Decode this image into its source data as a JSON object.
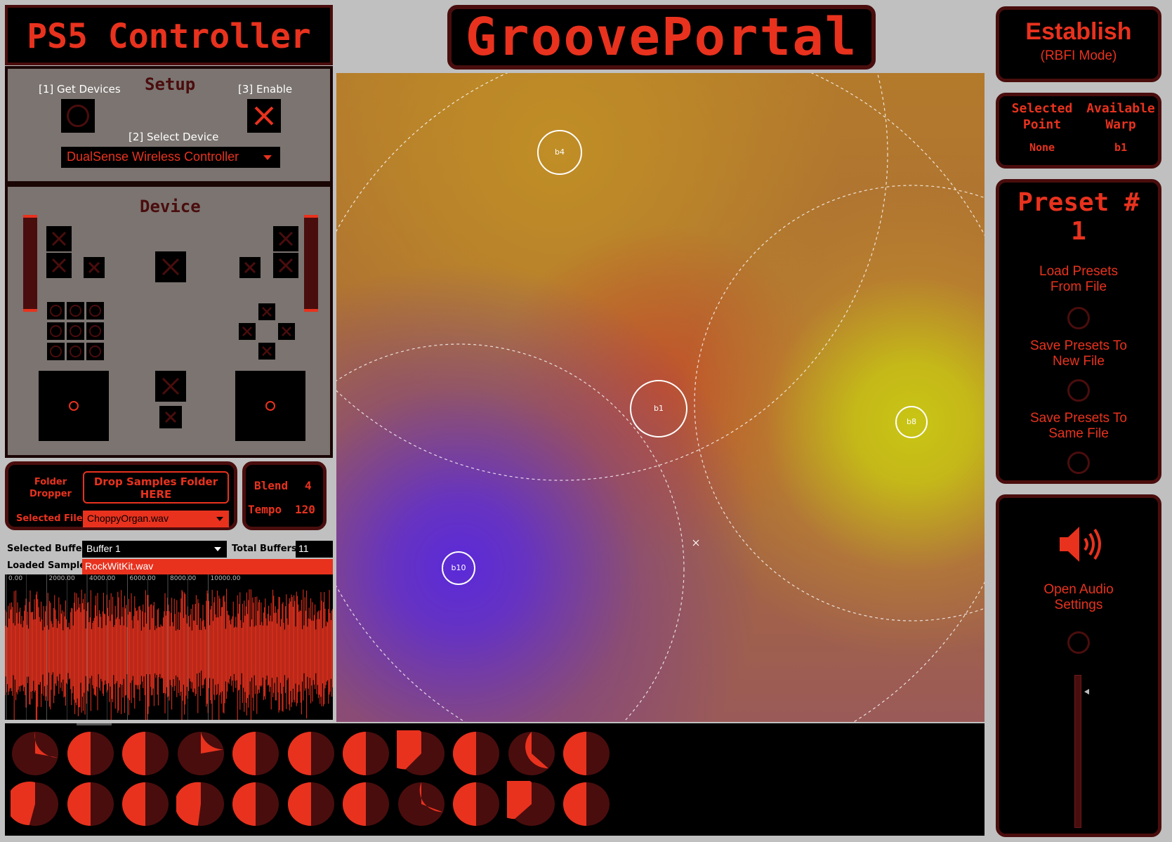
{
  "controller": {
    "title": "PS5 Controller",
    "setup_heading": "Setup",
    "get_devices_label": "[1] Get Devices",
    "enable_label": "[3] Enable",
    "select_device_label": "[2] Select Device",
    "device_value": "DualSense Wireless Controller",
    "device_heading": "Device"
  },
  "app_title": "GroovePortal",
  "establish": {
    "label": "Establish",
    "mode": "(RBFI Mode)"
  },
  "point_info": {
    "selected_point_label": "Selected Point",
    "selected_point_line1": "Selected",
    "selected_point_line2": "Point",
    "available_warp_line1": "Available",
    "available_warp_line2": "Warp",
    "selected_point_value": "None",
    "available_warp_value": "b1"
  },
  "preset": {
    "heading": "Preset #",
    "number": "1",
    "load_label_1": "Load Presets",
    "load_label_2": "From File",
    "save_new_1": "Save Presets To",
    "save_new_2": "New File",
    "save_same_1": "Save Presets To",
    "save_same_2": "Same File"
  },
  "audio": {
    "label_1": "Open Audio",
    "label_2": "Settings",
    "icon": "speaker-icon"
  },
  "samples": {
    "folder_dropper_1": "Folder",
    "folder_dropper_2": "Dropper",
    "drop_1": "Drop Samples Folder",
    "drop_2": "HERE",
    "selected_file_label": "Selected File",
    "selected_file_value": "ChoppyOrgan.wav"
  },
  "blend": {
    "blend_label": "Blend",
    "blend_value": "4",
    "tempo_label": "Tempo",
    "tempo_value": "120"
  },
  "buffer": {
    "selected_buffer_label": "Selected Buffer",
    "selected_buffer_value": "Buffer 1",
    "total_buffers_label": "Total Buffers",
    "total_buffers_value": "11",
    "loaded_sample_label": "Loaded Sample",
    "loaded_sample_value": "RockWitKit.wav",
    "ticks": [
      "0.00",
      "2000.00",
      "4000.00",
      "6000.00",
      "8000.00",
      "10000.00"
    ]
  },
  "warp_points": [
    {
      "id": "b4",
      "label": "b4"
    },
    {
      "id": "b1",
      "label": "b1"
    },
    {
      "id": "b8",
      "label": "b8"
    },
    {
      "id": "b10",
      "label": "b10"
    }
  ],
  "colors": {
    "accent": "#e8321e",
    "panel_border": "#4a0d0d",
    "b10_glow": "#5b2ad8",
    "b8_glow": "#c9c514",
    "field_base": "#b37a2c"
  },
  "knobs": {
    "row1": [
      0.28,
      0.5,
      0.5,
      0.22,
      0.5,
      0.5,
      0.5,
      0.62,
      0.5,
      0.37,
      0.5
    ],
    "row2": [
      0.54,
      0.5,
      0.5,
      0.52,
      0.5,
      0.5,
      0.5,
      0.31,
      0.5,
      0.63,
      0.5
    ]
  }
}
